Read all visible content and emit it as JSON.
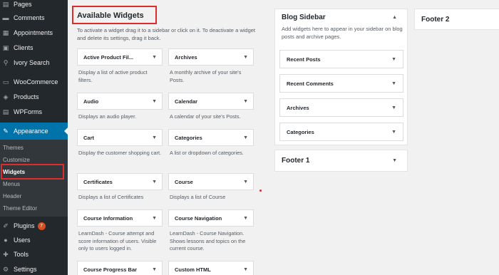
{
  "sidebar": {
    "items": [
      {
        "label": "Pages",
        "icon": "pages-icon",
        "glyph": "▤"
      },
      {
        "label": "Comments",
        "icon": "comments-icon",
        "glyph": "▬"
      },
      {
        "label": "Appointments",
        "icon": "calendar-icon",
        "glyph": "▦"
      },
      {
        "label": "Clients",
        "icon": "clients-icon",
        "glyph": "▣"
      },
      {
        "label": "Ivory Search",
        "icon": "search-icon",
        "glyph": "⚲"
      },
      {
        "label": "WooCommerce",
        "icon": "woocommerce-icon",
        "glyph": "▭"
      },
      {
        "label": "Products",
        "icon": "products-icon",
        "glyph": "◈"
      },
      {
        "label": "WPForms",
        "icon": "wpforms-icon",
        "glyph": "▤"
      },
      {
        "label": "Appearance",
        "icon": "appearance-icon",
        "glyph": "✎"
      }
    ],
    "submenu": [
      "Themes",
      "Customize",
      "Widgets",
      "Menus",
      "Header",
      "Theme Editor"
    ],
    "bottom": [
      {
        "label": "Plugins",
        "icon": "plugins-icon",
        "glyph": "✐",
        "badge": "7"
      },
      {
        "label": "Users",
        "icon": "users-icon",
        "glyph": "●"
      },
      {
        "label": "Tools",
        "icon": "tools-icon",
        "glyph": "✚"
      },
      {
        "label": "Settings",
        "icon": "settings-icon",
        "glyph": "⚙"
      }
    ]
  },
  "available": {
    "title": "Available Widgets",
    "description": "To activate a widget drag it to a sidebar or click on it. To deactivate a widget and delete its settings, drag it back.",
    "widgets": [
      {
        "title": "Active Product Fil...",
        "desc": "Display a list of active product filters."
      },
      {
        "title": "Archives",
        "desc": "A monthly archive of your site's Posts."
      },
      {
        "title": "Audio",
        "desc": "Displays an audio player."
      },
      {
        "title": "Calendar",
        "desc": "A calendar of your site's Posts."
      },
      {
        "title": "Cart",
        "desc": "Display the customer shopping cart."
      },
      {
        "title": "Categories",
        "desc": "A list or dropdown of categories."
      },
      {
        "title": "Certificates",
        "desc": "Displays a list of Certificates"
      },
      {
        "title": "Course",
        "desc": "Displays a list of Course"
      },
      {
        "title": "Course Information",
        "desc": "LearnDash - Course attempt and score information of users. Visible only to users logged in."
      },
      {
        "title": "Course Navigation",
        "desc": "LearnDash - Course Navigation. Shows lessons and topics on the current course."
      },
      {
        "title": "Course Progress Bar",
        "desc": ""
      },
      {
        "title": "Custom HTML",
        "desc": ""
      }
    ]
  },
  "blog_sidebar": {
    "title": "Blog Sidebar",
    "description": "Add widgets here to appear in your sidebar on blog posts and archive pages.",
    "widgets": [
      "Recent Posts",
      "Recent Comments",
      "Archives",
      "Categories"
    ]
  },
  "footer1": {
    "title": "Footer 1"
  },
  "footer2": {
    "title": "Footer 2"
  },
  "colors": {
    "accent": "#0073aa",
    "sidebar_bg": "#23282d",
    "highlight": "#e02b2b"
  }
}
